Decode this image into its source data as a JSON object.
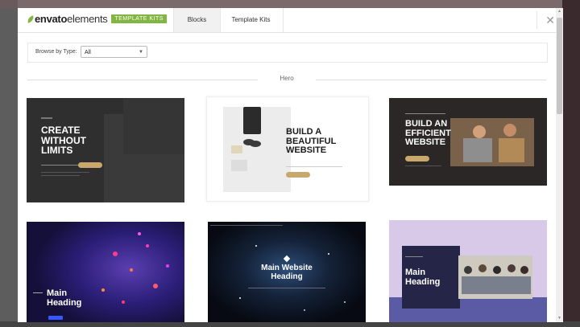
{
  "header": {
    "logo_brand": "envato",
    "logo_product": "elements",
    "badge": "TEMPLATE KITS",
    "tabs": [
      {
        "label": "Blocks",
        "active": true
      },
      {
        "label": "Template Kits",
        "active": false
      }
    ],
    "close_icon": "close-icon"
  },
  "filter": {
    "label": "Browse by Type:",
    "selected": "All"
  },
  "section": {
    "title": "Hero"
  },
  "cards": [
    {
      "heading": "CREATE\nWITHOUT\nLIMITS",
      "theme": "dark"
    },
    {
      "heading": "BUILD A\nBEAUTIFUL\nWEBSITE",
      "theme": "light"
    },
    {
      "heading": "BUILD AN\nEFFICIENT\nWEBSITE",
      "theme": "dark"
    },
    {
      "heading": "Main\nHeading",
      "theme": "neon"
    },
    {
      "heading": "Main Website\nHeading",
      "theme": "space"
    },
    {
      "heading": "Main\nHeading",
      "theme": "purple"
    }
  ],
  "colors": {
    "brand_green": "#82b541",
    "gold_button": "#c8a96b"
  }
}
